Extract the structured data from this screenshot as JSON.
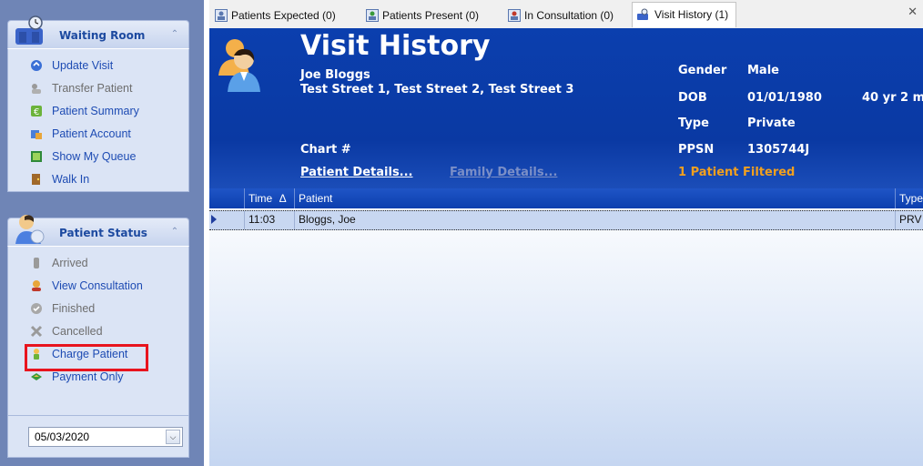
{
  "sidebar": {
    "waiting_room": {
      "title": "Waiting Room",
      "items": [
        {
          "label": "Update Visit",
          "icon": "update-visit-icon"
        },
        {
          "label": "Transfer Patient",
          "icon": "transfer-patient-icon"
        },
        {
          "label": "Patient Summary",
          "icon": "patient-summary-icon"
        },
        {
          "label": "Patient Account",
          "icon": "patient-account-icon"
        },
        {
          "label": "Show My Queue",
          "icon": "show-queue-icon"
        },
        {
          "label": "Walk In",
          "icon": "walk-in-icon"
        }
      ]
    },
    "patient_status": {
      "title": "Patient Status",
      "items": [
        {
          "label": "Arrived",
          "icon": "arrived-icon"
        },
        {
          "label": "View Consultation",
          "icon": "view-consultation-icon"
        },
        {
          "label": "Finished",
          "icon": "finished-icon"
        },
        {
          "label": "Cancelled",
          "icon": "cancelled-icon"
        },
        {
          "label": "Charge Patient",
          "icon": "charge-patient-icon"
        },
        {
          "label": "Payment Only",
          "icon": "payment-only-icon"
        }
      ]
    },
    "date": "05/03/2020"
  },
  "tabs": [
    {
      "label": "Patients Expected (0)"
    },
    {
      "label": "Patients Present (0)"
    },
    {
      "label": "In Consultation (0)"
    },
    {
      "label": "Visit History (1)"
    }
  ],
  "header": {
    "title": "Visit History",
    "patient_name": "Joe Bloggs",
    "address": "Test Street 1, Test Street 2, Test Street 3",
    "chart_label": "Chart #",
    "patient_details_link": "Patient Details...",
    "family_details_link": "Family Details...",
    "gender_label": "Gender",
    "gender_value": "Male",
    "dob_label": "DOB",
    "dob_value": "01/01/1980",
    "age_value": "40 yr 2 m",
    "type_label": "Type",
    "type_value": "Private",
    "ppsn_label": "PPSN",
    "ppsn_value": "1305744J",
    "filtered_text": "1 Patient Filtered"
  },
  "grid": {
    "columns": [
      "Time",
      "Patient",
      "Type"
    ],
    "sort_indicator": "Δ",
    "rows": [
      {
        "time": "11:03",
        "patient": "Bloggs, Joe",
        "type": "PRV"
      }
    ]
  },
  "colors": {
    "header_blue": "#0a39a3",
    "accent_orange": "#f2a01e",
    "highlight_red": "#e8141e"
  }
}
